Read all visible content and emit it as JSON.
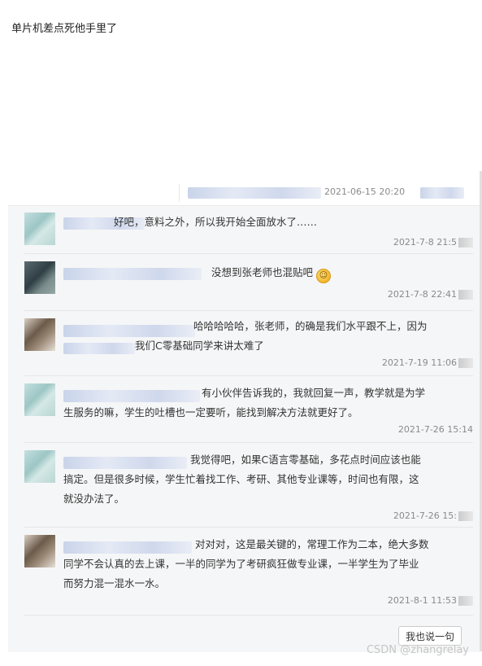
{
  "headline": "单片机差点死他手里了",
  "top_meta": {
    "date": "2021-06-15 20:20"
  },
  "comments": [
    {
      "text_lines": [
        "好吧，意料之外，所以我开始全面放水了……"
      ],
      "time": "2021-7-8 21:5"
    },
    {
      "text_lines": [
        "没想到张老师也混贴吧"
      ],
      "time": "2021-7-8 22:41",
      "emoji": "smile-emoji"
    },
    {
      "text_lines": [
        "哈哈哈哈哈，张老师，的确是我们水平跟不上，因为",
        "我们C零基础同学来讲太难了"
      ],
      "time": "2021-7-19 11:06"
    },
    {
      "text_lines": [
        "有小伙伴告诉我的，我就回复一声，教学就是为学",
        "生服务的嘛，学生的吐槽也一定要听，能找到解决方法就更好了。"
      ],
      "time": "2021-7-26 15:14"
    },
    {
      "text_lines": [
        "我觉得吧，如果C语言零基础，多花点时间应该也能",
        "搞定。但是很多时候，学生忙着找工作、考研、其他专业课等，时间也有限，这",
        "就没办法了。"
      ],
      "time": "2021-7-26 15:"
    },
    {
      "text_lines": [
        "对对对，这是最关键的，常理工作为二本，绝大多数",
        "同学不会认真的去上课，一半的同学为了考研疯狂做专业课，一半学生为了毕业",
        "而努力混一混水一水。"
      ],
      "time": "2021-8-1 11:53"
    }
  ],
  "reply_button": "我也说一句",
  "watermark": "CSDN @zhangrelay",
  "colors": {
    "panel": "#f5f6f7",
    "text": "#333333",
    "muted": "#8a8a8a"
  }
}
